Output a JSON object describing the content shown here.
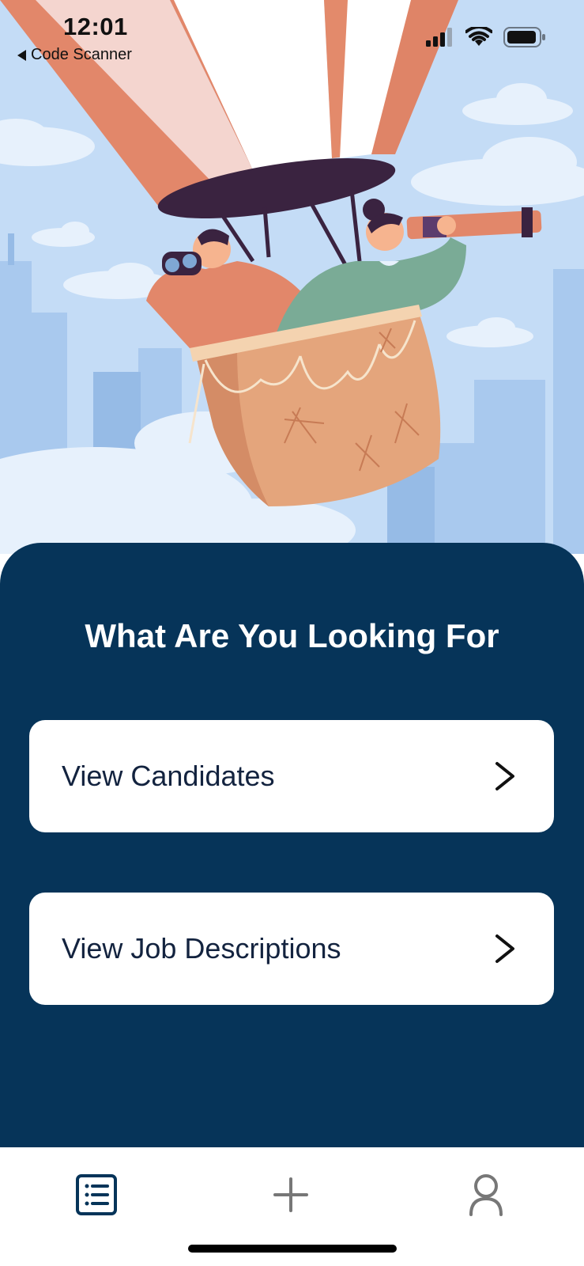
{
  "status_bar": {
    "time": "12:01",
    "back_label": "Code Scanner",
    "icons": [
      "signal-icon",
      "wifi-icon",
      "battery-icon"
    ]
  },
  "hero": {
    "illustration": "hot-air-balloon-illustration"
  },
  "main": {
    "title": "What Are You Looking For",
    "options": [
      {
        "label": "View Candidates",
        "icon": "chevron-right-icon"
      },
      {
        "label": "View Job Descriptions",
        "icon": "chevron-right-icon"
      }
    ]
  },
  "tab_bar": {
    "items": [
      {
        "icon": "list-icon",
        "active": true
      },
      {
        "icon": "plus-icon",
        "active": false
      },
      {
        "icon": "person-icon",
        "active": false
      }
    ]
  },
  "colors": {
    "panel_bg": "#063459",
    "card_bg": "#ffffff",
    "active_tab": "#063459",
    "inactive_tab": "#777777"
  }
}
